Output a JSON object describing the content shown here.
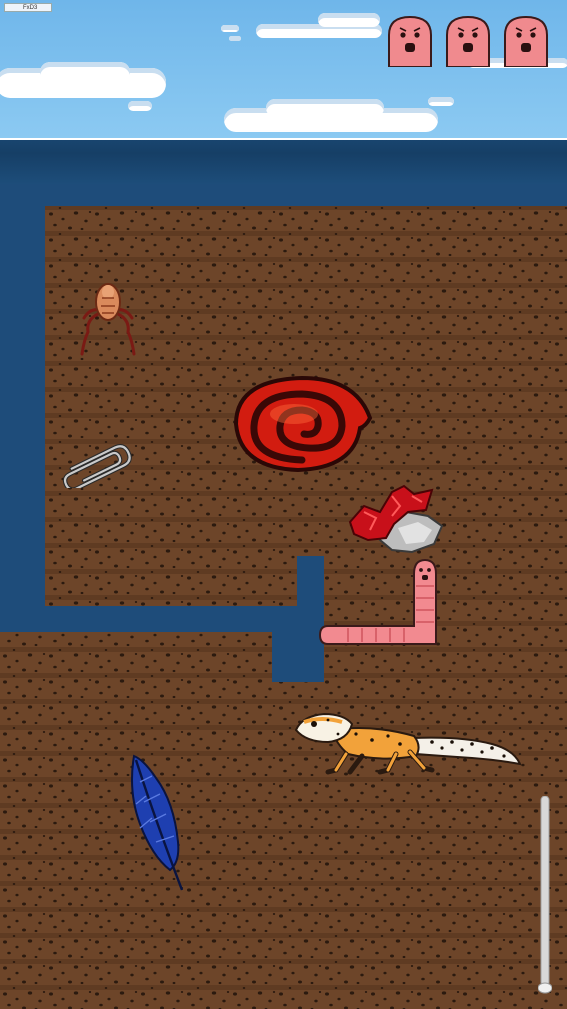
{
  "hud": {
    "fps_label": "FxD3",
    "lives_remaining": 3,
    "life_icon": "pink-worm-face-icon"
  },
  "world": {
    "sky_color": "#7cc0ee",
    "water_color": "#1b4774",
    "tunnel_color": "#1e4e7e",
    "soil_color": "#6b4428"
  },
  "objects": [
    {
      "name": "flea-enemy",
      "icon": "flea-icon"
    },
    {
      "name": "red-snail-shell",
      "icon": "snail-shell-icon"
    },
    {
      "name": "paperclip",
      "icon": "paperclip-icon"
    },
    {
      "name": "red-crystal-rock",
      "icon": "crystal-rock-icon"
    },
    {
      "name": "player-worm",
      "icon": "pink-worm-icon"
    },
    {
      "name": "leopard-gecko-enemy",
      "icon": "gecko-icon"
    },
    {
      "name": "blue-feather",
      "icon": "feather-icon"
    }
  ],
  "depth_meter": {
    "level": 0.0
  }
}
